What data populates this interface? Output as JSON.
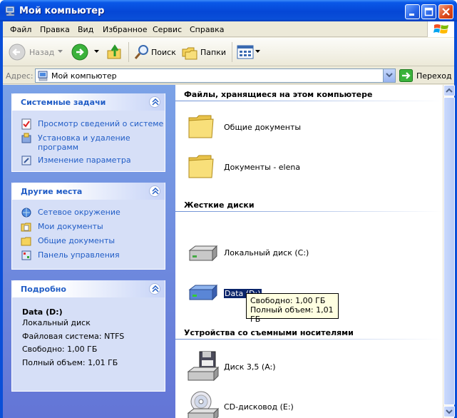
{
  "window": {
    "title": "Мой компьютер"
  },
  "menubar": {
    "items": [
      "Файл",
      "Правка",
      "Вид",
      "Избранное",
      "Сервис",
      "Справка"
    ]
  },
  "toolbar": {
    "back_label": "Назад",
    "search_label": "Поиск",
    "folders_label": "Папки"
  },
  "address": {
    "label": "Адрес:",
    "value": "Мой компьютер",
    "go_label": "Переход"
  },
  "left_pane": {
    "system_tasks": {
      "title": "Системные задачи",
      "items": [
        "Просмотр сведений о системе",
        "Установка и удаление",
        "программ",
        "Изменение параметра"
      ]
    },
    "other_places": {
      "title": "Другие места",
      "items": [
        "Сетевое окружение",
        "Мои документы",
        "Общие документы",
        "Панель управления"
      ]
    },
    "details": {
      "title": "Подробно",
      "name": "Data (D:)",
      "type": "Локальный диск",
      "fs": "Файловая система: NTFS",
      "free": "Свободно: 1,00 ГБ",
      "total": "Полный объем: 1,01 ГБ"
    }
  },
  "right_pane": {
    "groups": [
      {
        "title": "Файлы, хранящиеся на этом компьютере",
        "items": [
          "Общие документы",
          "Документы - elena"
        ]
      },
      {
        "title": "Жесткие диски",
        "items": [
          "Локальный диск (C:)",
          "Data (D:)"
        ]
      },
      {
        "title": "Устройства со съемными носителями",
        "items": [
          "Диск 3,5 (A:)",
          "CD-дисковод (E:)"
        ]
      }
    ]
  },
  "tooltip": {
    "line1": "Свободно: 1,00 ГБ",
    "line2": "Полный объем: 1,01 ГБ"
  },
  "colors": {
    "titlebar": "#0a4fd8",
    "link": "#215dc6",
    "selection": "#0a246a",
    "tooltip_bg": "#ffffe1"
  }
}
